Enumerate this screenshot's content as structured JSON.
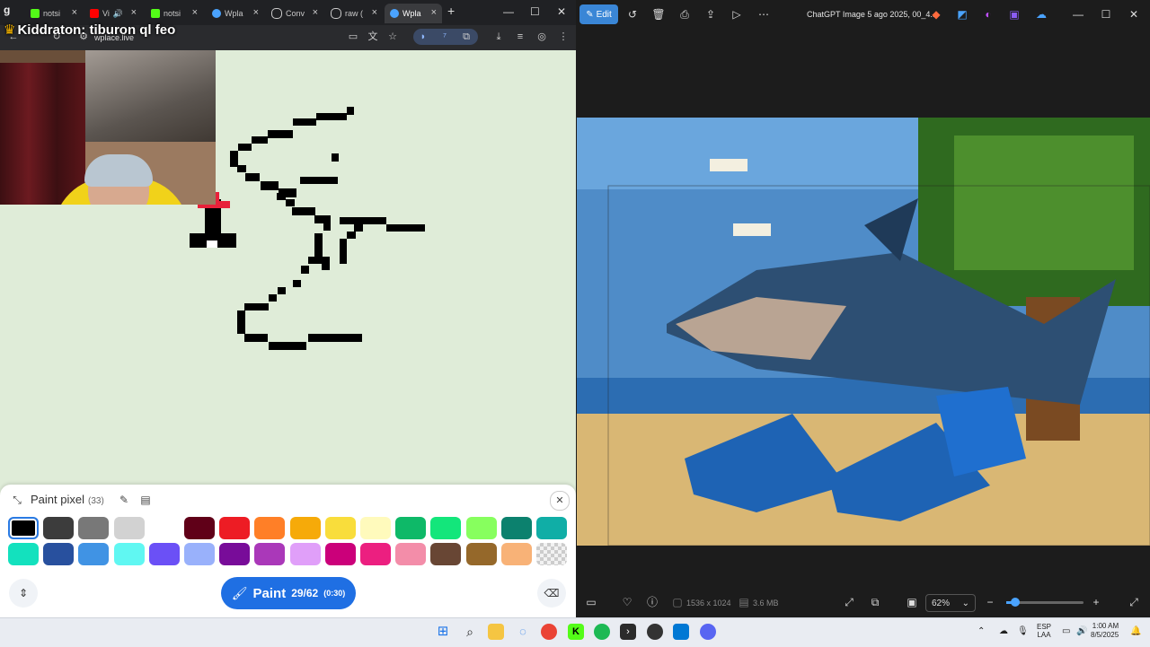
{
  "browser": {
    "tabs": [
      {
        "label": "notsi",
        "icon": "kick-icon",
        "color": "#53fc18"
      },
      {
        "label": "Vi",
        "icon": "youtube-icon",
        "color": "#ff0000"
      },
      {
        "label": "notsi",
        "icon": "kick-icon",
        "color": "#53fc18"
      },
      {
        "label": "Wpla",
        "icon": "wplace-icon",
        "color": "#4aa3ff"
      },
      {
        "label": "Conv",
        "icon": "chatgpt-icon",
        "color": "#cccccc"
      },
      {
        "label": "raw (",
        "icon": "globe-icon",
        "color": "#cccccc"
      },
      {
        "label": "Wpla",
        "icon": "wplace-icon",
        "color": "#4aa3ff",
        "active": true
      }
    ],
    "url": "wplace.live",
    "chat_overlay": {
      "badge": "Kiddraton:",
      "message": "tiburon ql feo"
    }
  },
  "paint_panel": {
    "title": "Paint pixel",
    "count": "(33)",
    "palette": [
      [
        "#000000",
        "#3c3c3c",
        "#787878",
        "#d2d2d2",
        "#ffffff",
        "#600018",
        "#ed1c24",
        "#ff7f27",
        "#f6aa09",
        "#f9dd3b",
        "#fffabc",
        "#0eb968",
        "#13e67b",
        "#87ff5e",
        "#0c816e",
        "#10aea6"
      ],
      [
        "#13e1be",
        "#28509e",
        "#4093e4",
        "#60f7f2",
        "#6b50f6",
        "#99b1fb",
        "#780c99",
        "#aa38b9",
        "#e09ff9",
        "#cb007a",
        "#ec1f80",
        "#f38da9",
        "#684634",
        "#95682a",
        "#f8b277",
        "transparent"
      ]
    ],
    "paint_button": {
      "label": "Paint",
      "progress": "29/62",
      "timer": "(0:30)"
    }
  },
  "viewer": {
    "edit_label": "Edit",
    "title": "ChatGPT Image 5 ago 2025, 00_4...",
    "dimensions": "1536 x 1024",
    "filesize": "3.6 MB",
    "zoom": "62%",
    "zoom_level": 0.1
  },
  "taskbar": {
    "lang_1": "ESP",
    "lang_2": "LAA",
    "time": "1:00 AM",
    "date": "8/5/2025"
  }
}
